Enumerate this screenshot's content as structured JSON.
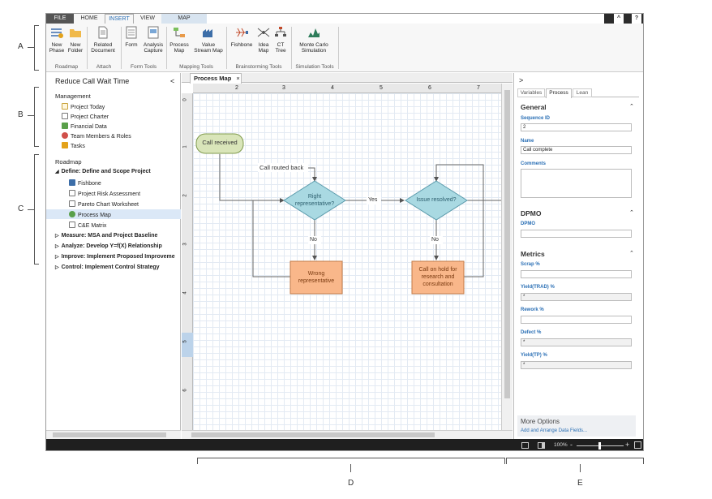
{
  "callouts": {
    "a": "A",
    "b": "B",
    "c": "C",
    "d": "D",
    "e": "E"
  },
  "menubar": {
    "tabs": [
      "FILE",
      "HOME",
      "INSERT",
      "VIEW",
      "MAP"
    ],
    "active": "INSERT",
    "caret": "^",
    "help": "?"
  },
  "ribbon": {
    "buttons": [
      {
        "label": "New\nPhase",
        "icon": "new-phase-icon"
      },
      {
        "label": "New\nFolder",
        "icon": "new-folder-icon"
      },
      {
        "label": "Related\nDocument",
        "icon": "related-document-icon"
      },
      {
        "label": "Form",
        "icon": "form-icon"
      },
      {
        "label": "Analysis\nCapture",
        "icon": "analysis-capture-icon"
      },
      {
        "label": "Process\nMap",
        "icon": "process-map-icon"
      },
      {
        "label": "Value\nStream Map",
        "icon": "value-stream-map-icon"
      },
      {
        "label": "Fishbone",
        "icon": "fishbone-icon"
      },
      {
        "label": "Idea\nMap",
        "icon": "idea-map-icon"
      },
      {
        "label": "CT\nTree",
        "icon": "ct-tree-icon"
      },
      {
        "label": "Monte Carlo\nSimulation",
        "icon": "monte-carlo-icon"
      }
    ],
    "groups": [
      "Roadmap",
      "Attach",
      "Form Tools",
      "Mapping Tools",
      "Brainstorming Tools",
      "Simulation Tools"
    ]
  },
  "left": {
    "project_title": "Reduce Call Wait Time",
    "collapse": "<",
    "management_header": "Management",
    "management_items": [
      "Project Today",
      "Project Charter",
      "Financial Data",
      "Team Members & Roles",
      "Tasks"
    ],
    "roadmap_header": "Roadmap",
    "phase_define": "Define: Define and Scope Project",
    "define_items": [
      "Fishbone",
      "Project Risk Assessment",
      "Pareto Chart Worksheet",
      "Process Map",
      "C&E Matrix"
    ],
    "selected_item": "Process Map",
    "other_phases": [
      "Measure: MSA and Project Baseline",
      "Analyze: Develop Y=f(X) Relationship",
      "Improve: Implement Proposed Improveme",
      "Control: Implement Control Strategy"
    ]
  },
  "canvas": {
    "tab_label": "Process Map",
    "tab_close": "×",
    "ruler_h": [
      "2",
      "3",
      "4",
      "5",
      "6",
      "7"
    ],
    "ruler_v": [
      "0",
      "1",
      "2",
      "3",
      "4",
      "5",
      "6"
    ],
    "shapes": {
      "start": "Call received",
      "loop_label": "Call routed back",
      "decision1": "Right\nrepresentative?",
      "yes_label": "Yes",
      "decision2": "Issue resolved?",
      "no1": "No",
      "no2": "No",
      "process1": "Wrong\nrepresentative",
      "process2": "Call on hold for\nresearch and\nconsultation"
    },
    "colors": {
      "start": "#d9e5b9",
      "decision": "#a9d9e2",
      "process": "#f9b78a"
    }
  },
  "right": {
    "expand": ">",
    "tabs": [
      "Variables",
      "Process",
      "Lean"
    ],
    "active_tab": "Process",
    "general_header": "General",
    "sequence_label": "Sequence ID",
    "sequence_value": "2",
    "name_label": "Name",
    "name_value": "Call complete",
    "comments_label": "Comments",
    "dpmo_header": "DPMO",
    "dpmo_label": "DPMO",
    "metrics_header": "Metrics",
    "metrics": [
      {
        "label": "Scrap %",
        "value": "",
        "readonly": false
      },
      {
        "label": "Yield(TRAD) %",
        "value": "*",
        "readonly": true
      },
      {
        "label": "Rework %",
        "value": "",
        "readonly": false
      },
      {
        "label": "Defect %",
        "value": "*",
        "readonly": true
      },
      {
        "label": "Yield(TP) %",
        "value": "*",
        "readonly": true
      }
    ],
    "more_options": "More Options",
    "add_fields_link": "Add and Arrange Data Fields..."
  },
  "status": {
    "zoom": "100%",
    "minus": "-",
    "plus": "+"
  }
}
